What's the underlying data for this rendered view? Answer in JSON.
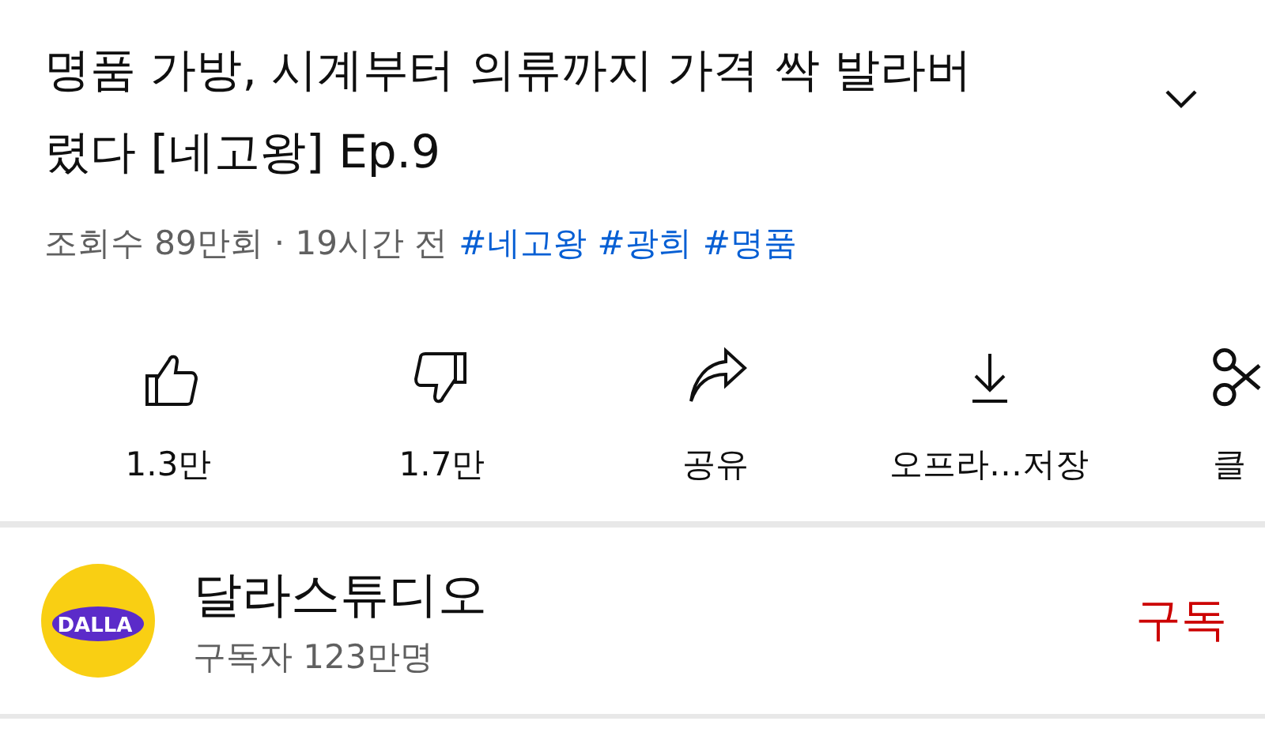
{
  "video": {
    "title": "명품 가방, 시계부터 의류까지 가격 싹 발라버렸다 [네고왕] Ep.9",
    "views": "조회수 89만회",
    "time": "· 19시간 전",
    "hashtags": [
      "#네고왕",
      "#광희",
      "#명품"
    ]
  },
  "actions": [
    {
      "kind": "like",
      "label": "1.3만"
    },
    {
      "kind": "dislike",
      "label": "1.7만"
    },
    {
      "kind": "share",
      "label": "공유"
    },
    {
      "kind": "download",
      "label": "오프라…저장"
    },
    {
      "kind": "clip",
      "label": "클"
    }
  ],
  "channel": {
    "logo_text": "DALLA",
    "name": "달라스튜디오",
    "subscribers": "구독자 123만명",
    "subscribe": "구독"
  }
}
